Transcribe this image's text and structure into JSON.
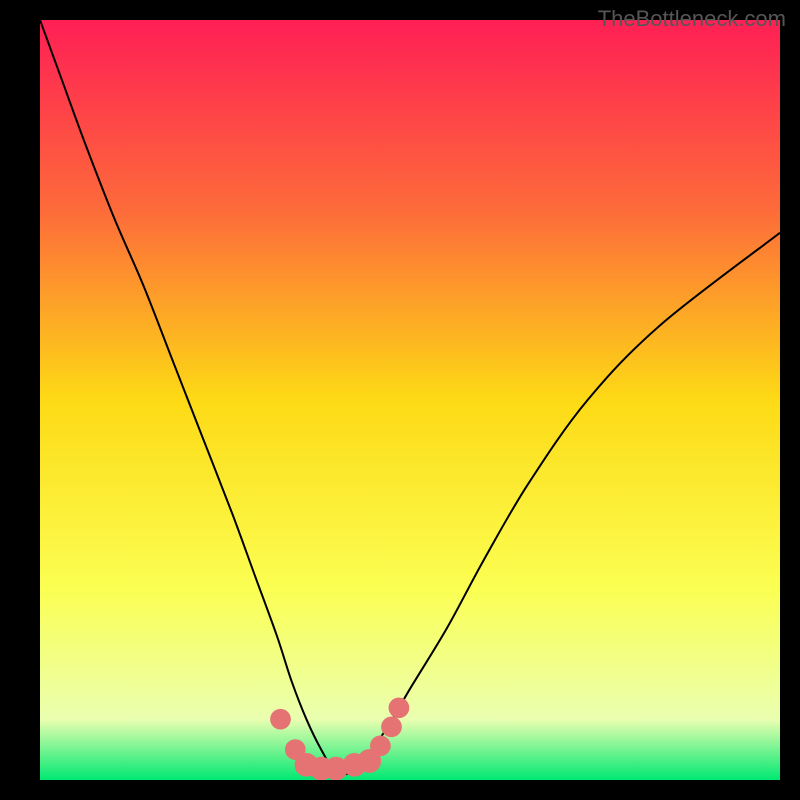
{
  "watermark": "TheBottleneck.com",
  "chart_data": {
    "type": "line",
    "title": "",
    "xlabel": "",
    "ylabel": "",
    "xlim": [
      0,
      100
    ],
    "ylim": [
      0,
      100
    ],
    "gradient_stops": [
      {
        "offset": 0,
        "color": "#ff1f55"
      },
      {
        "offset": 25,
        "color": "#fd6b3a"
      },
      {
        "offset": 50,
        "color": "#fdda15"
      },
      {
        "offset": 75,
        "color": "#fbff53"
      },
      {
        "offset": 92,
        "color": "#eaffb0"
      },
      {
        "offset": 100,
        "color": "#00e873"
      }
    ],
    "series": [
      {
        "name": "bottleneck-curve",
        "x": [
          0,
          3,
          6,
          10,
          14,
          18,
          22,
          26,
          29,
          32,
          34,
          36,
          38,
          40,
          42,
          44,
          47,
          50,
          55,
          60,
          66,
          74,
          84,
          100
        ],
        "values": [
          100,
          92,
          84,
          74,
          65,
          55,
          45,
          35,
          27,
          19,
          13,
          8,
          4,
          1,
          1,
          3,
          7,
          12,
          20,
          29,
          39,
          50,
          60,
          72
        ]
      }
    ],
    "markers": {
      "name": "optimal-range-markers",
      "x": [
        32.5,
        34.5,
        36.0,
        38.0,
        40.0,
        42.5,
        44.5,
        46.0,
        47.5,
        48.5
      ],
      "values": [
        8.0,
        4.0,
        2.0,
        1.5,
        1.5,
        2.0,
        2.5,
        4.5,
        7.0,
        9.5
      ],
      "radius": [
        1.4,
        1.4,
        1.6,
        1.6,
        1.6,
        1.6,
        1.6,
        1.4,
        1.4,
        1.4
      ],
      "color": "#e57373"
    }
  }
}
